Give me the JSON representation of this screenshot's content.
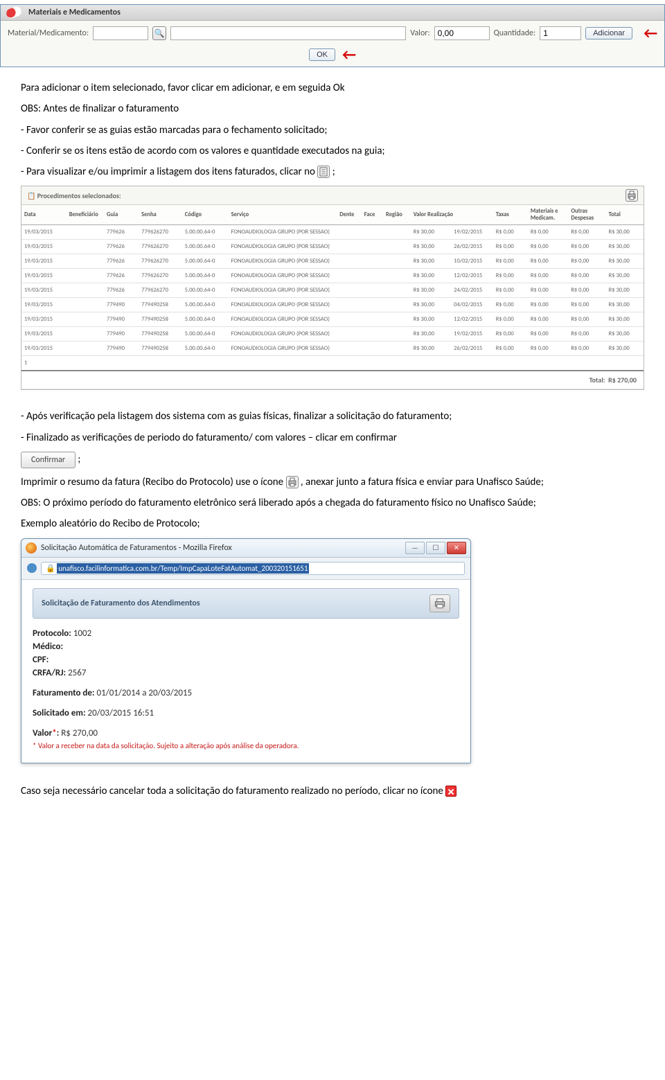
{
  "mats_panel": {
    "title": "Materiais e Medicamentos",
    "material_label": "Material/Medicamento:",
    "valor_label": "Valor:",
    "valor_value": "0,00",
    "qtd_label": "Quantidade:",
    "qtd_value": "1",
    "add_label": "Adicionar",
    "ok_label": "OK"
  },
  "body": {
    "p1": "Para adicionar o item selecionado, favor clicar em adicionar, e em seguida Ok",
    "p2": "OBS: Antes de finalizar o faturamento",
    "p3": "- Favor conferir se as guias estão marcadas para o fechamento solicitado;",
    "p4": "- Conferir se os itens estão de acordo com os valores e quantidade executados na guia;",
    "p5_a": "- Para visualizar e/ou imprimir a listagem dos itens faturados, clicar no",
    "p5_b": " ;",
    "p6": "- Após verificação pela listagem dos sistema com as guias físicas, finalizar a solicitação do faturamento;",
    "p7": "- Finalizado as verificações de periodo do faturamento/ com valores – clicar em confirmar",
    "confirm_label": "Confirmar",
    "p8_a": "Imprimir o resumo da fatura (Recibo do Protocolo) use o ícone ",
    "p8_b": ", anexar junto a fatura física e enviar para Unafisco Saúde;",
    "p9": "OBS: O próximo período do faturamento eletrônico será liberado após a chegada do faturamento físico no Unafisco Saúde;",
    "p10": "Exemplo aleatório do Recibo de Protocolo;",
    "p11": "Caso seja necessário cancelar toda a solicitação do faturamento realizado no período, clicar no ícone"
  },
  "proc_table": {
    "header": "Procedimentos selecionados:",
    "columns": [
      "Data",
      "Beneficiário",
      "Guia",
      "Senha",
      "Código",
      "Serviço",
      "Dente",
      "Face",
      "Região",
      "Valor Realização",
      "Taxas",
      "Materiais e Medicam.",
      "Outras Despesas",
      "Total"
    ],
    "rows": [
      {
        "data": "19/03/2015",
        "guia": "779626",
        "senha": "779626270",
        "codigo": "5.00.00.64-0",
        "servico": "FONOAUDIOLOGIA GRUPO (POR SESSAO)",
        "valor": "R$ 30,00",
        "realiz": "19/02/2015",
        "taxas": "R$ 0,00",
        "mat": "R$ 0,00",
        "out": "R$ 0,00",
        "total": "R$ 30,00"
      },
      {
        "data": "19/03/2015",
        "guia": "779626",
        "senha": "779626270",
        "codigo": "5.00.00.64-0",
        "servico": "FONOAUDIOLOGIA GRUPO (POR SESSAO)",
        "valor": "R$ 30,00",
        "realiz": "26/02/2015",
        "taxas": "R$ 0,00",
        "mat": "R$ 0,00",
        "out": "R$ 0,00",
        "total": "R$ 30,00"
      },
      {
        "data": "19/03/2015",
        "guia": "779626",
        "senha": "779626270",
        "codigo": "5.00.00.64-0",
        "servico": "FONOAUDIOLOGIA GRUPO (POR SESSAO)",
        "valor": "R$ 30,00",
        "realiz": "10/02/2015",
        "taxas": "R$ 0,00",
        "mat": "R$ 0,00",
        "out": "R$ 0,00",
        "total": "R$ 30,00"
      },
      {
        "data": "19/03/2015",
        "guia": "779626",
        "senha": "779626270",
        "codigo": "5.00.00.64-0",
        "servico": "FONOAUDIOLOGIA GRUPO (POR SESSAO)",
        "valor": "R$ 30,00",
        "realiz": "12/02/2015",
        "taxas": "R$ 0,00",
        "mat": "R$ 0,00",
        "out": "R$ 0,00",
        "total": "R$ 30,00"
      },
      {
        "data": "19/03/2015",
        "guia": "779626",
        "senha": "779626270",
        "codigo": "5.00.00.64-0",
        "servico": "FONOAUDIOLOGIA GRUPO (POR SESSAO)",
        "valor": "R$ 30,00",
        "realiz": "24/02/2015",
        "taxas": "R$ 0,00",
        "mat": "R$ 0,00",
        "out": "R$ 0,00",
        "total": "R$ 30,00"
      },
      {
        "data": "19/03/2015",
        "guia": "779490",
        "senha": "779490258",
        "codigo": "5.00.00.64-0",
        "servico": "FONOAUDIOLOGIA GRUPO (POR SESSAO)",
        "valor": "R$ 30,00",
        "realiz": "04/02/2015",
        "taxas": "R$ 0,00",
        "mat": "R$ 0,00",
        "out": "R$ 0,00",
        "total": "R$ 30,00"
      },
      {
        "data": "19/03/2015",
        "guia": "779490",
        "senha": "779490258",
        "codigo": "5.00.00.64-0",
        "servico": "FONOAUDIOLOGIA GRUPO (POR SESSAO)",
        "valor": "R$ 30,00",
        "realiz": "12/02/2015",
        "taxas": "R$ 0,00",
        "mat": "R$ 0,00",
        "out": "R$ 0,00",
        "total": "R$ 30,00"
      },
      {
        "data": "19/03/2015",
        "guia": "779490",
        "senha": "779490258",
        "codigo": "5.00.00.64-0",
        "servico": "FONOAUDIOLOGIA GRUPO (POR SESSAO)",
        "valor": "R$ 30,00",
        "realiz": "19/02/2015",
        "taxas": "R$ 0,00",
        "mat": "R$ 0,00",
        "out": "R$ 0,00",
        "total": "R$ 30,00"
      },
      {
        "data": "19/03/2015",
        "guia": "779490",
        "senha": "779490258",
        "codigo": "5.00.00.64-0",
        "servico": "FONOAUDIOLOGIA GRUPO (POR SESSAO)",
        "valor": "R$ 30,00",
        "realiz": "26/02/2015",
        "taxas": "R$ 0,00",
        "mat": "R$ 0,00",
        "out": "R$ 0,00",
        "total": "R$ 30,00"
      }
    ],
    "page_indicator": "1",
    "total_label": "Total:",
    "total_value": "R$ 270,00"
  },
  "ff": {
    "title": "Solicitação Automática de Faturamentos - Mozilla Firefox",
    "url": "unafisco.facilinformatica.com.br/Temp/ImpCapaLoteFatAutomat_200320151651",
    "heading": "Solicitação de Faturamento dos Atendimentos",
    "protocolo_label": "Protocolo:",
    "protocolo_value": "1002",
    "medico_label": "Médico:",
    "cpf_label": "CPF:",
    "crfa_label": "CRFA/RJ:",
    "crfa_value": "2567",
    "faturamento_label": "Faturamento de:",
    "faturamento_value": "01/01/2014 a 20/03/2015",
    "solicitado_label": "Solicitado em:",
    "solicitado_value": "20/03/2015 16:51",
    "valor_label": "Valor",
    "valor_value": "R$ 270,00",
    "note": "* Valor a receber na data da solicitação. Sujeito a alteração após análise da operadora."
  }
}
